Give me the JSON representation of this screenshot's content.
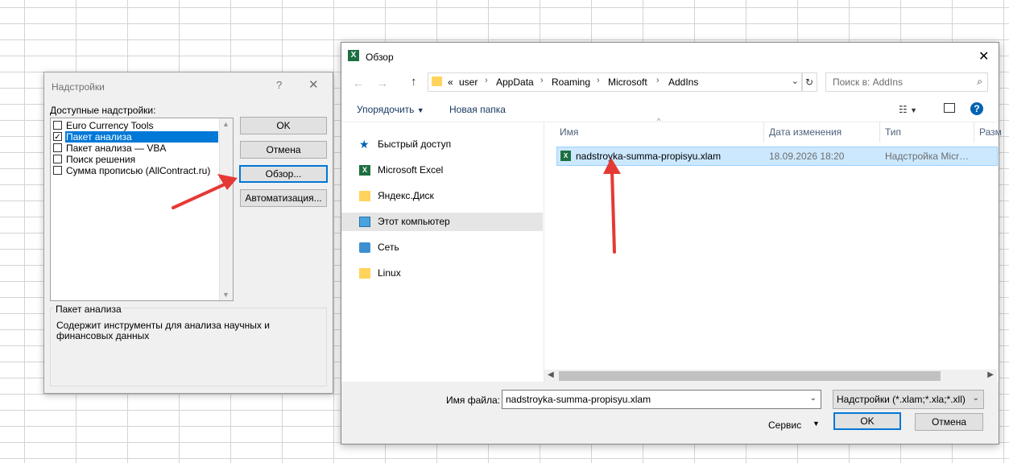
{
  "addins_dialog": {
    "title": "Надстройки",
    "help_glyph": "?",
    "close_glyph": "✕",
    "available_label": "Доступные надстройки:",
    "items": [
      {
        "label": "Euro Currency Tools",
        "checked": false,
        "selected": false
      },
      {
        "label": "Пакет анализа",
        "checked": true,
        "selected": true
      },
      {
        "label": "Пакет анализа — VBA",
        "checked": false,
        "selected": false
      },
      {
        "label": "Поиск решения",
        "checked": false,
        "selected": false
      },
      {
        "label": "Сумма прописью (AllContract.ru)",
        "checked": false,
        "selected": false
      }
    ],
    "buttons": {
      "ok": "OK",
      "cancel": "Отмена",
      "browse": "Обзор...",
      "automation": "Автоматизация..."
    },
    "description": {
      "title": "Пакет анализа",
      "text": "Содержит инструменты для анализа научных и финансовых данных"
    }
  },
  "browse_dialog": {
    "title": "Обзор",
    "app_icon_letter": "X",
    "close_glyph": "✕",
    "address": {
      "prefix": "«",
      "crumbs": [
        "user",
        "AppData",
        "Roaming",
        "Microsoft",
        "AddIns"
      ]
    },
    "search_placeholder": "Поиск в: AddIns",
    "toolbar": {
      "organize": "Упорядочить",
      "new_folder": "Новая папка",
      "help": "?"
    },
    "nav_items": [
      {
        "label": "Быстрый доступ",
        "icon": "star-icon",
        "active": false
      },
      {
        "label": "Microsoft Excel",
        "icon": "excel-icon",
        "active": false
      },
      {
        "label": "Яндекс.Диск",
        "icon": "yandex-disk-icon",
        "active": false
      },
      {
        "label": "Этот компьютер",
        "icon": "computer-icon",
        "active": true
      },
      {
        "label": "Сеть",
        "icon": "network-icon",
        "active": false
      },
      {
        "label": "Linux",
        "icon": "folder-icon",
        "active": false
      }
    ],
    "columns": {
      "name": "Имя",
      "date": "Дата изменения",
      "type": "Тип",
      "size": "Разм"
    },
    "files": [
      {
        "name": "nadstroyka-summa-propisyu.xlam",
        "date": "18.09.2026 18:20",
        "type": "Надстройка Micr…"
      }
    ],
    "filename_label": "Имя файла:",
    "filename_value": "nadstroyka-summa-propisyu.xlam",
    "filetype_value": "Надстройки (*.xlam;*.xla;*.xll)",
    "tools_label": "Сервис",
    "ok": "OK",
    "cancel": "Отмена"
  },
  "colors": {
    "accent": "#0078d7",
    "selection": "#cce8ff",
    "excel_green": "#1d6f42",
    "arrow_red": "#e53935"
  }
}
